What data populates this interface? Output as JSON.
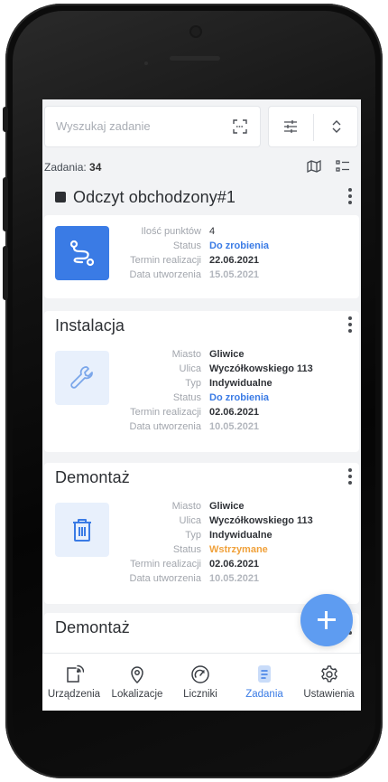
{
  "search": {
    "placeholder": "Wyszukaj zadanie"
  },
  "tasks_count": {
    "label": "Zadania:",
    "value": "34"
  },
  "cards": [
    {
      "title": "Odczyt obchodzony#1",
      "rows": [
        {
          "k": "Ilość punktów",
          "v": "4"
        },
        {
          "k": "Status",
          "v": "Do zrobienia"
        },
        {
          "k": "Termin realizacji",
          "v": "22.06.2021"
        },
        {
          "k": "Data utworzenia",
          "v": "15.05.2021"
        }
      ]
    },
    {
      "title": "Instalacja",
      "rows": [
        {
          "k": "Miasto",
          "v": "Gliwice"
        },
        {
          "k": "Ulica",
          "v": "Wyczółkowskiego 113"
        },
        {
          "k": "Typ",
          "v": "Indywidualne"
        },
        {
          "k": "Status",
          "v": "Do zrobienia"
        },
        {
          "k": "Termin realizacji",
          "v": "02.06.2021"
        },
        {
          "k": "Data utworzenia",
          "v": "10.05.2021"
        }
      ]
    },
    {
      "title": "Demontaż",
      "rows": [
        {
          "k": "Miasto",
          "v": "Gliwice"
        },
        {
          "k": "Ulica",
          "v": "Wyczółkowskiego 113"
        },
        {
          "k": "Typ",
          "v": "Indywidualne"
        },
        {
          "k": "Status",
          "v": "Wstrzymane"
        },
        {
          "k": "Termin realizacji",
          "v": "02.06.2021"
        },
        {
          "k": "Data utworzenia",
          "v": "10.05.2021"
        }
      ]
    },
    {
      "title": "Demontaż"
    }
  ],
  "nav": {
    "items": [
      "Urządzenia",
      "Lokalizacje",
      "Liczniki",
      "Zadania",
      "Ustawienia"
    ],
    "active": "Zadania"
  },
  "colors": {
    "accent": "#3a7be5",
    "warning": "#f0a13b",
    "fab": "#5e9cf1"
  },
  "icons": [
    "qr-scan-icon",
    "filter-sliders-icon",
    "sort-chevrons-icon",
    "map-icon",
    "list-icon",
    "route-icon",
    "wrench-icon",
    "trash-icon",
    "plus-icon",
    "device-signal-icon",
    "location-pin-icon",
    "gauge-icon",
    "document-icon",
    "gear-icon"
  ]
}
